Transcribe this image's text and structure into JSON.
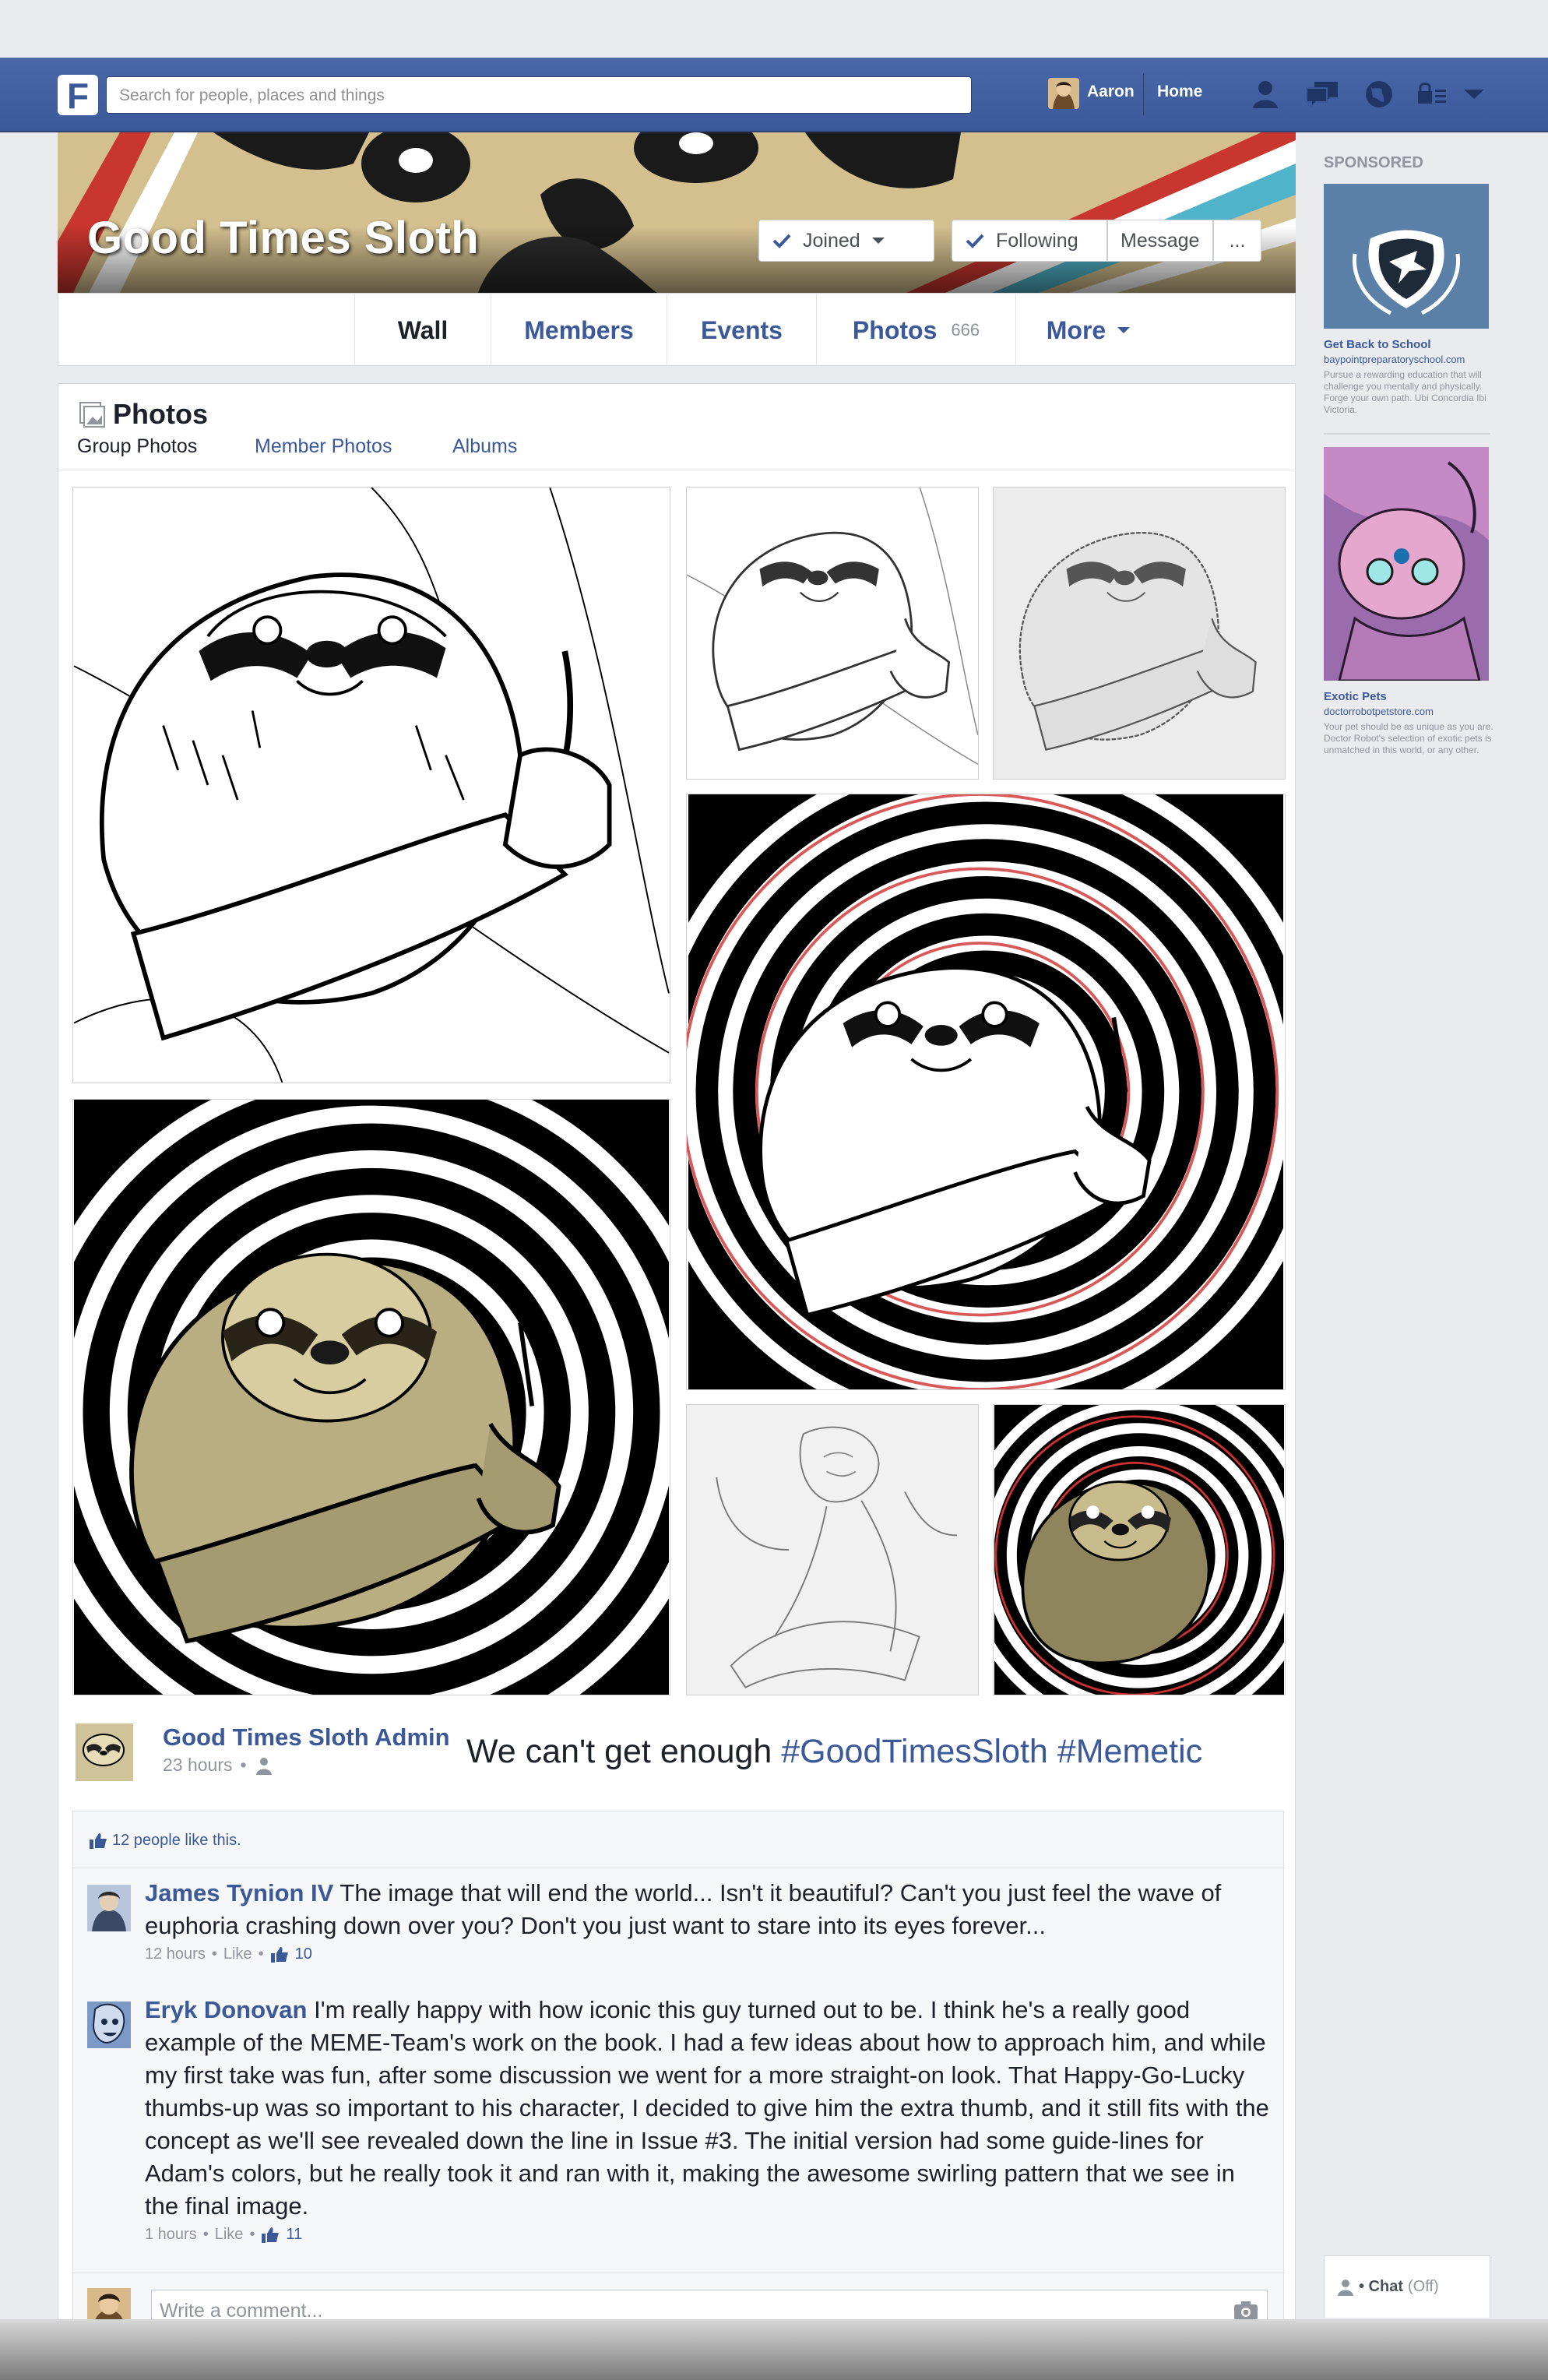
{
  "topbar": {
    "logo": "F",
    "search_placeholder": "Search for people, places and things",
    "user_name": "Aaron",
    "home_label": "Home",
    "icons": [
      "friends-icon",
      "messages-icon",
      "globe-icon",
      "privacy-icon",
      "dropdown-arrow-icon"
    ]
  },
  "group": {
    "name": "Good Times Sloth",
    "buttons": {
      "joined": "Joined",
      "following": "Following",
      "message": "Message",
      "more": "..."
    }
  },
  "tabs": [
    {
      "label": "Wall",
      "active": true
    },
    {
      "label": "Members"
    },
    {
      "label": "Events"
    },
    {
      "label": "Photos",
      "count": "666"
    },
    {
      "label": "More"
    }
  ],
  "photos": {
    "title": "Photos",
    "subtabs": [
      "Group Photos",
      "Member Photos",
      "Albums"
    ]
  },
  "post": {
    "author": "Good Times Sloth Admin",
    "time": "23 hours",
    "text": "We can't get enough ",
    "hashtags": [
      "#GoodTimesSloth",
      "#Memetic"
    ],
    "likes_text": "12 people like this."
  },
  "comments": [
    {
      "author": "James Tynion IV",
      "text": "The image that will end the world... Isn't it beautiful? Can't you just feel the wave of euphoria crashing down over you? Don't you just want to stare into its eyes forever...",
      "time": "12 hours",
      "like_label": "Like",
      "likes": "10"
    },
    {
      "author": "Eryk Donovan",
      "text": "I'm really happy with how iconic this guy turned out to be. I think he's a really good example of the MEME-Team's work on the book. I had a few ideas about how to approach him, and while my first take was fun, after some discussion we went for a more straight-on look. That Happy-Go-Lucky thumbs-up was so important to his character, I decided to give him the extra thumb, and it still fits with the concept as we'll see revealed down the line in Issue #3. The initial version had some guide-lines for Adam's colors, but he really took it and ran with it, making the awesome swirling pattern that we see in the final image.",
      "time": "1 hours",
      "like_label": "Like",
      "likes": "11"
    }
  ],
  "comment_box_placeholder": "Write a comment...",
  "sidebar": {
    "sponsored_label": "SPONSORED",
    "ads": [
      {
        "title": "Get Back to School",
        "url": "baypointpreparatoryschool.com",
        "text": "Pursue a rewarding education that will challenge you mentally and physically. Forge your own path. Ubi Concordia Ibi Victoria."
      },
      {
        "title": "Exotic Pets",
        "url": "doctorrobotpetstore.com",
        "text": "Your pet should be as unique as you are. Doctor Robot's selection of exotic pets is unmatched in this world, or any other."
      }
    ],
    "chat_label": "• Chat",
    "chat_status": "(Off)"
  },
  "colors": {
    "brand_blue": "#3b5998",
    "page_bg": "#e9ebee"
  }
}
